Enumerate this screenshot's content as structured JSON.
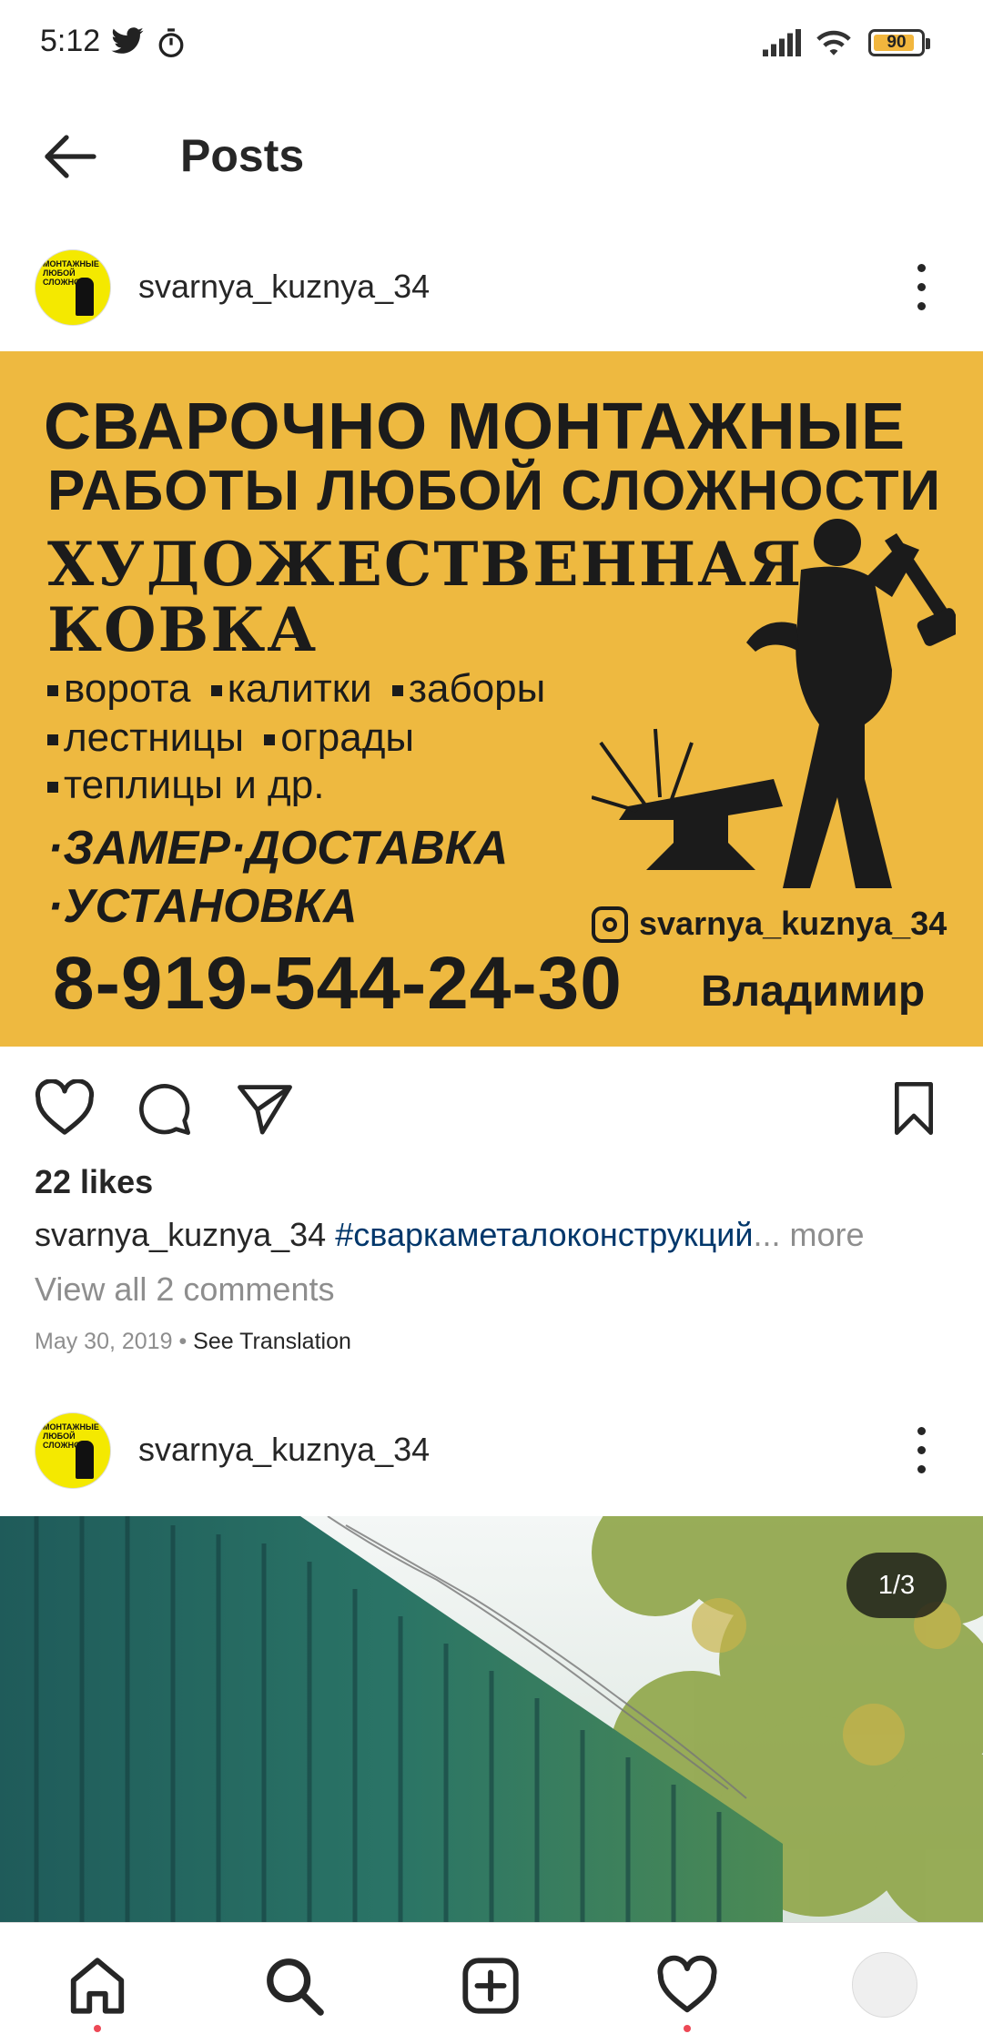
{
  "status_bar": {
    "time": "5:12",
    "battery": "90",
    "battery_level_pct": 90,
    "icons": [
      "twitter-icon",
      "stopwatch-icon",
      "signal-icon",
      "wifi-icon",
      "battery-icon"
    ]
  },
  "header": {
    "title": "Posts",
    "back_icon": "arrow-left-icon"
  },
  "posts": [
    {
      "username": "svarnya_kuznya_34",
      "avatar_text": "МОНТАЖНЫЕ ЛЮБОЙ СЛОЖНОСТ",
      "banner": {
        "line1": "СВАРОЧНО МОНТАЖНЫЕ",
        "line2": "РАБОТЫ ЛЮБОЙ СЛОЖНОСТИ",
        "line3": "ХУДОЖЕСТВЕННАЯ",
        "line4": "КОВКА",
        "bullet1": "ворота",
        "bullet2": "калитки",
        "bullet3": "заборы",
        "bullet4": "лестницы",
        "bullet5": "ограды",
        "bullet6": "теплицы и др.",
        "big1": "·ЗАМЕР·ДОСТАВКА",
        "big2": "·УСТАНОВКА",
        "handle": "svarnya_kuznya_34",
        "phone": "8-919-544-24-30",
        "name": "Владимир"
      },
      "likes": "22 likes",
      "caption_user": "svarnya_kuznya_34",
      "caption_tag": "#сваркаметалоконструкций",
      "caption_ellipsis": "...",
      "caption_more": "more",
      "view_comments": "View all 2 comments",
      "date": "May 30, 2019",
      "date_separator": "•",
      "see_translation": "See Translation"
    },
    {
      "username": "svarnya_kuznya_34",
      "carousel_counter": "1/3"
    }
  ],
  "bottom_nav": {
    "items": [
      "home-icon",
      "search-icon",
      "new-post-icon",
      "activity-icon",
      "profile-avatar"
    ],
    "accent": "#ed4956"
  },
  "colors": {
    "banner_bg": "#eeb940",
    "hashtag": "#00376b",
    "muted": "#8e8e8e"
  }
}
